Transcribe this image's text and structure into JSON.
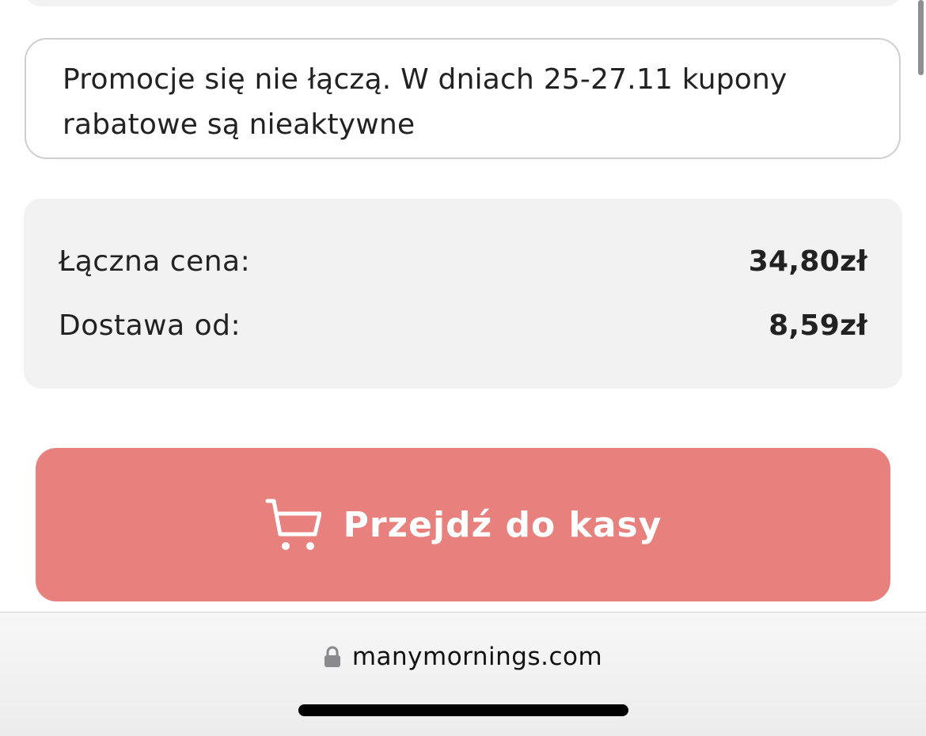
{
  "promo_notice": {
    "text": "Promocje się nie łączą. W dniach 25-27.11 kupony rabatowe są nieaktywne"
  },
  "summary": {
    "total_label": "Łączna cena:",
    "total_value": "34,80zł",
    "delivery_label": "Dostawa od:",
    "delivery_value": "8,59zł"
  },
  "checkout": {
    "label": "Przejdź do kasy",
    "icon": "cart-icon",
    "color": "#e8817d"
  },
  "browser": {
    "url": "manymornings.com",
    "icon": "lock-icon"
  }
}
